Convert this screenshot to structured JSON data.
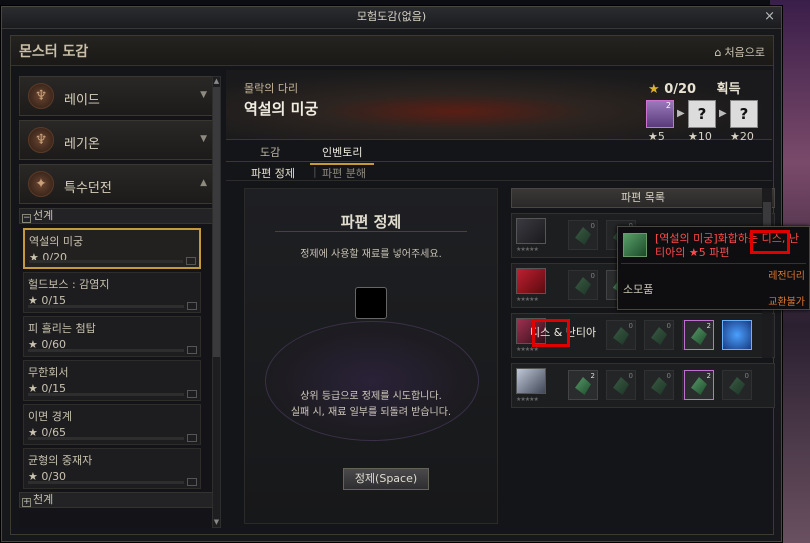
{
  "window": {
    "title": "모험도감(없음)",
    "close": "×"
  },
  "header": {
    "title": "몬스터 도감",
    "home_label": "처음으로"
  },
  "sidebar": {
    "categories": [
      {
        "label": "레이드",
        "arrow": "▼"
      },
      {
        "label": "레기온",
        "arrow": "▼"
      },
      {
        "label": "특수던전",
        "arrow": "▲"
      }
    ],
    "group_open": {
      "toggle": "−",
      "label": "선계"
    },
    "group_closed": {
      "toggle": "+",
      "label": "천계"
    },
    "dungeons": [
      {
        "name": "역설의 미궁",
        "progress": "★ 0/20",
        "selected": true
      },
      {
        "name": "헐드보스 : 감염지",
        "progress": "★ 0/15"
      },
      {
        "name": "피 흘리는 첨탑",
        "progress": "★ 0/60"
      },
      {
        "name": "무한회서",
        "progress": "★ 0/15"
      },
      {
        "name": "이면 경계",
        "progress": "★ 0/65"
      },
      {
        "name": "균형의 중재자",
        "progress": "★ 0/30"
      }
    ]
  },
  "banner": {
    "subtitle": "몰락의 다리",
    "title": "역설의 미궁",
    "progress_star": "★",
    "progress": "0/20",
    "reward_label": "획득",
    "rewards": [
      {
        "label": "★5",
        "count": "2"
      },
      {
        "label": "★10",
        "mark": "?"
      },
      {
        "label": "★20",
        "mark": "?"
      }
    ]
  },
  "tabs": {
    "encyclopedia": "도감",
    "inventory": "인벤토리"
  },
  "subtabs": {
    "refine": "파편 정제",
    "sep": "|",
    "disassemble": "파편 분해"
  },
  "refine": {
    "title": "파편 정제",
    "hint": "정제에 사용할 재료를 넣어주세요.",
    "info1": "상위 등급으로 정제를 시도합니다.",
    "info2": "실패 시, 재료 일부를 되돌려 받습니다.",
    "button": "정제(Space)"
  },
  "fragment_list": {
    "header": "파편 목록",
    "rows": [
      {
        "stars": "★★★★★",
        "counts": [
          "0",
          "0"
        ]
      },
      {
        "stars": "★★★★★",
        "counts": [
          "0",
          "0"
        ]
      },
      {
        "stars": "★★★★★",
        "name": "디스 & 난티아",
        "counts": [
          "0",
          "0",
          "0",
          "2",
          ""
        ]
      },
      {
        "stars": "★★★★★",
        "counts": [
          "2",
          "0",
          "0",
          "0",
          "2",
          "0"
        ]
      }
    ]
  },
  "tooltip": {
    "name": "[역설의 미궁]화합하는 디스, 난티아의 ★5 파편",
    "grade": "레전더리",
    "type": "소모품",
    "trade": "교환불가"
  },
  "colors": {
    "accent": "#c49a3a",
    "highlight": "#e00000",
    "legendary": "#e07830"
  }
}
